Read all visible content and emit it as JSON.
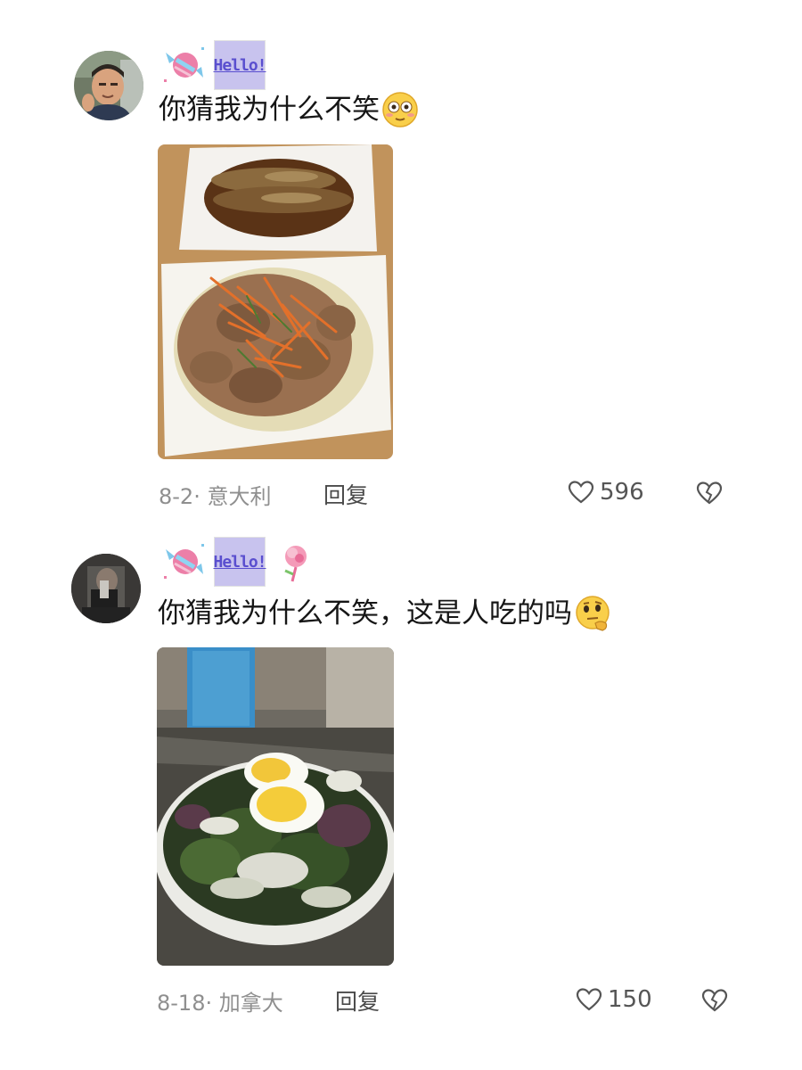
{
  "comments": [
    {
      "text": "你猜我为什么不笑",
      "badge_text": "Hello!",
      "date": "8-2",
      "location": "意大利",
      "reply_label": "回复",
      "likes": "596",
      "emoji": "flushed-emoji"
    },
    {
      "text": "你猜我为什么不笑，这是人吃的吗",
      "badge_text": "Hello!",
      "date": "8-18",
      "location": "加拿大",
      "reply_label": "回复",
      "likes": "150",
      "emoji": "thinking-emoji"
    }
  ],
  "meta_separator": "·"
}
